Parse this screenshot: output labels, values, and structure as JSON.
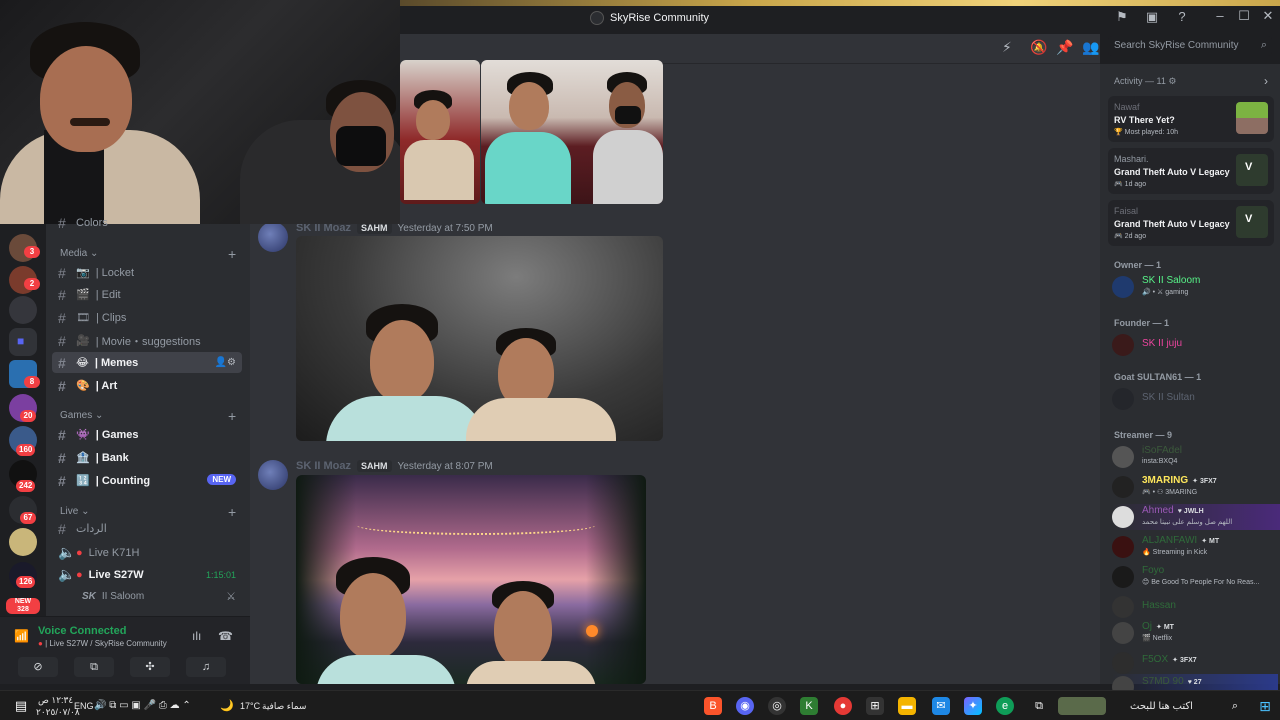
{
  "window": {
    "title": "SkyRise Community",
    "search_placeholder": "Search SkyRise Community"
  },
  "sidebar": {
    "categories": [
      {
        "label": "Media",
        "channels": [
          {
            "emoji": "📷",
            "label": "| Locket"
          },
          {
            "emoji": "🎬",
            "label": "| Edit"
          },
          {
            "emoji": "🎞",
            "label": "| Clips"
          },
          {
            "emoji": "🎥",
            "label": "| Movie・suggestions"
          },
          {
            "emoji": "😂",
            "label": "| Memes"
          },
          {
            "emoji": "🎨",
            "label": "| Art"
          }
        ]
      },
      {
        "label": "Games",
        "channels": [
          {
            "emoji": "👾",
            "label": "| Games"
          },
          {
            "emoji": "🏦",
            "label": "| Bank"
          },
          {
            "emoji": "🔢",
            "label": "| Counting",
            "badge": "NEW"
          }
        ]
      },
      {
        "label": "Live",
        "channels": [
          {
            "label": "الردات"
          },
          {
            "label": "Live K71H"
          },
          {
            "label": "Live S27W",
            "timer": "1:15:01"
          }
        ]
      }
    ],
    "voice_user": {
      "prefix": "SK",
      "name": "II Saloom"
    },
    "top_channel_partial": "Colors",
    "guild_badges": [
      "3",
      "2",
      "8",
      "20",
      "160",
      "242",
      "67",
      "126",
      "NEW 328"
    ]
  },
  "voice_panel": {
    "status": "Voice Connected",
    "location": "| Live S27W / SkyRise Community"
  },
  "messages": [
    {
      "author": "SK II Moaz",
      "tag": "SAHM",
      "time": "Yesterday at 7:50 PM"
    },
    {
      "author": "SK II Moaz",
      "tag": "SAHM",
      "time": "Yesterday at 8:07 PM"
    }
  ],
  "members": {
    "activity_header": "Activity — 11",
    "activities": [
      {
        "user": "Nawaf",
        "game": "RV There Yet?",
        "detail": "Most played: 10h"
      },
      {
        "user": "Mashari.",
        "game": "Grand Theft Auto V Legacy",
        "detail": "1d ago"
      },
      {
        "user": "Faisal",
        "game": "Grand Theft Auto V Legacy",
        "detail": "2d ago"
      }
    ],
    "owner_header": "Owner — 1",
    "owner": {
      "name": "SK II Saloom",
      "status": "gaming"
    },
    "founder_header": "Founder — 1",
    "founder": {
      "name": "SK II juju"
    },
    "goat_header": "Goat SULTAN61 — 1",
    "goat": {
      "name": "SK II Sultan"
    },
    "streamer_header": "Streamer — 9",
    "streamers": [
      {
        "name": "iSoFAdel",
        "status": "insta:BXQ4",
        "tag": ""
      },
      {
        "name": "3MARING",
        "status": "3MARING",
        "tag": "3FX7"
      },
      {
        "name": "Ahmed",
        "status": "اللهم صل وسلم على نبينا محمد",
        "tag": "JWLH"
      },
      {
        "name": "ALJANFAWI",
        "status": "Streaming in Kick",
        "tag": "MT"
      },
      {
        "name": "Foyo",
        "status": "Be Good To People For No Reas...",
        "tag": ""
      },
      {
        "name": "Hassan",
        "status": "",
        "tag": ""
      },
      {
        "name": "Oj",
        "status": "Netflix",
        "tag": "MT"
      },
      {
        "name": "F5OX",
        "status": "",
        "tag": "3FX7"
      },
      {
        "name": "S7MD 90",
        "status": "",
        "tag": "27"
      }
    ]
  },
  "taskbar": {
    "date": "٢٠٢٥/٠٧/٠٨",
    "time": "١٢:٣٤ ص",
    "lang": "ENG",
    "weather_temp": "17°C",
    "weather_text": "سماء صافية",
    "search_placeholder": "اكتب هنا للبحث"
  }
}
